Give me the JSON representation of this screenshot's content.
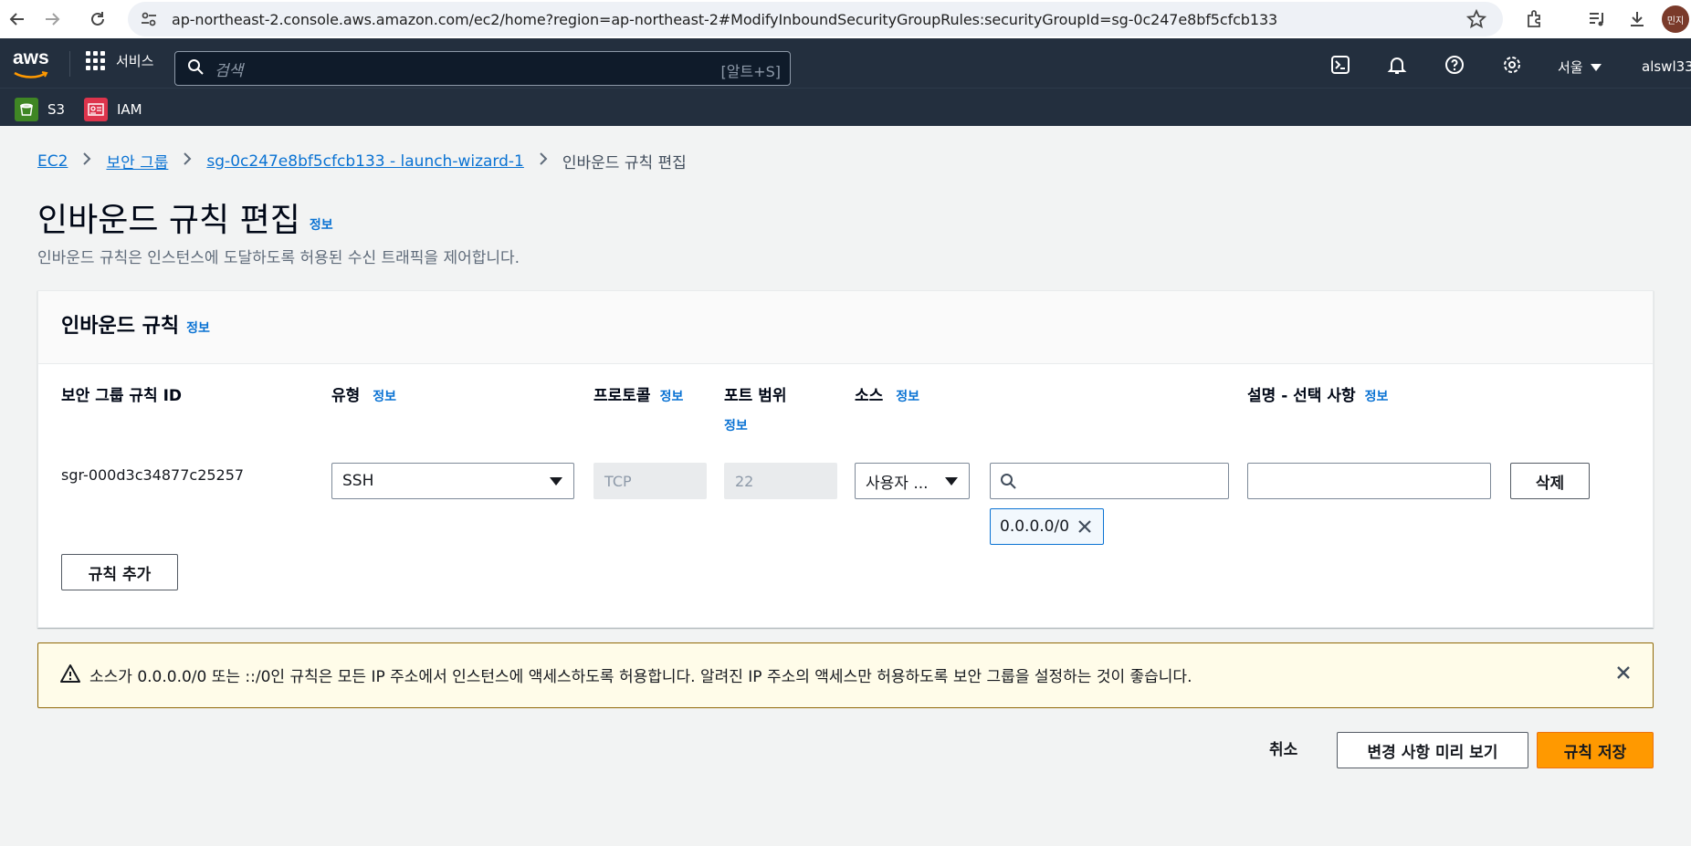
{
  "browser": {
    "url": "ap-northeast-2.console.aws.amazon.com/ec2/home?region=ap-northeast-2#ModifyInboundSecurityGroupRules:securityGroupId=sg-0c247e8bf5cfcb133",
    "profile_initials": "민지"
  },
  "header": {
    "logo": "aws",
    "services_label": "서비스",
    "search_placeholder": "검색",
    "search_shortcut": "[알트+S]",
    "region": "서울",
    "account": "alswl33"
  },
  "favorites": [
    {
      "label": "S3",
      "color": "#3f8624"
    },
    {
      "label": "IAM",
      "color": "#dd344c"
    }
  ],
  "breadcrumb": {
    "items": [
      "EC2",
      "보안 그룹",
      "sg-0c247e8bf5cfcb133 - launch-wizard-1"
    ],
    "current": "인바운드 규칙 편집"
  },
  "page": {
    "title": "인바운드 규칙 편집",
    "info": "정보",
    "description": "인바운드 규칙은 인스턴스에 도달하도록 허용된 수신 트래픽을 제어합니다."
  },
  "panel": {
    "title": "인바운드 규칙",
    "info": "정보",
    "columns": {
      "rule_id": "보안 그룹 규칙 ID",
      "type": "유형",
      "protocol": "프로토콜",
      "port_range": "포트 범위",
      "source": "소스",
      "description": "설명 - 선택 사항"
    },
    "row": {
      "rule_id": "sgr-000d3c34877c25257",
      "type": "SSH",
      "protocol": "TCP",
      "port": "22",
      "source_type": "사용자 ...",
      "source_search": "",
      "source_token": "0.0.0.0/0",
      "description": "",
      "delete_label": "삭제"
    },
    "add_rule_label": "규칙 추가"
  },
  "alert": {
    "message": "소스가 0.0.0.0/0 또는 ::/0인 규칙은 모든 IP 주소에서 인스턴스에 액세스하도록 허용합니다. 알려진 IP 주소의 액세스만 허용하도록 보안 그룹을 설정하는 것이 좋습니다."
  },
  "footer": {
    "cancel": "취소",
    "preview": "변경 사항 미리 보기",
    "save": "규칙 저장"
  }
}
